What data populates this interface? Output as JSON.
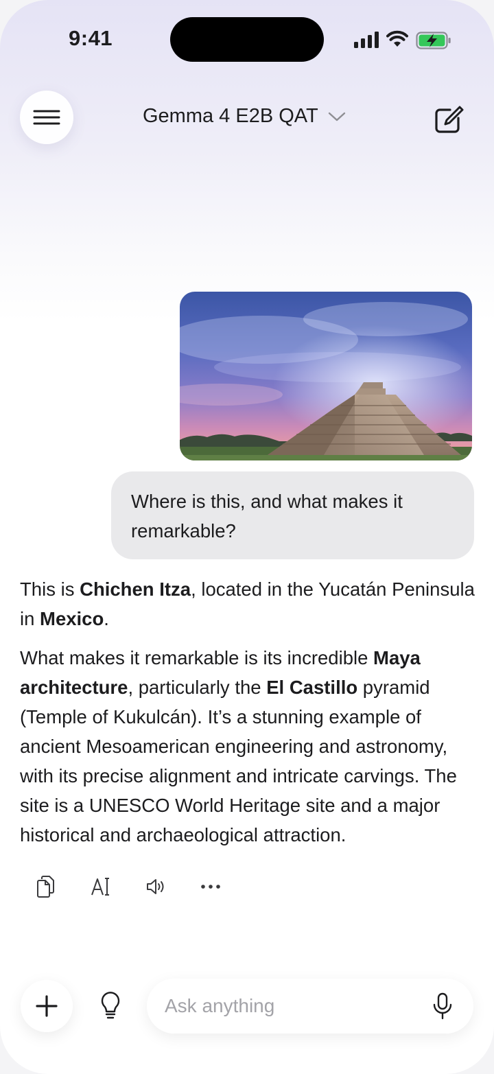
{
  "status_bar": {
    "time": "9:41"
  },
  "header": {
    "model_name": "Gemma 4 E2B QAT"
  },
  "conversation": {
    "user_message": "Where is this, and what makes it remarkable?",
    "assistant": {
      "p1": {
        "t1": "This is ",
        "b1": "Chichen Itza",
        "t2": ", located in the Yucatán Peninsula in ",
        "b2": "Mexico",
        "t3": "."
      },
      "p2": {
        "t1": "What makes it remarkable is its incredible ",
        "b1": "Maya architecture",
        "t2": ", particularly the ",
        "b2": "El Castillo",
        "t3": " pyramid (Temple of Kukulcán). It’s a stunning example of ancient Mesoamerican engineering and astronomy, with its precise alignment and intricate carvings. The site is a UNESCO World Heritage site and a major historical and archaeological attraction."
      }
    }
  },
  "message_actions": [
    "copy-icon",
    "select-text-icon",
    "read-aloud-icon",
    "more-icon"
  ],
  "composer": {
    "placeholder": "Ask anything"
  },
  "icons": {
    "menu": "menu-icon",
    "chevron": "chevron-down-icon",
    "compose": "compose-icon",
    "plus": "plus-icon",
    "bulb": "lightbulb-icon",
    "mic": "microphone-icon"
  },
  "colors": {
    "battery_green": "#34c759",
    "bubble_gray": "#e9e9eb",
    "placeholder_gray": "#a3a3a8"
  }
}
